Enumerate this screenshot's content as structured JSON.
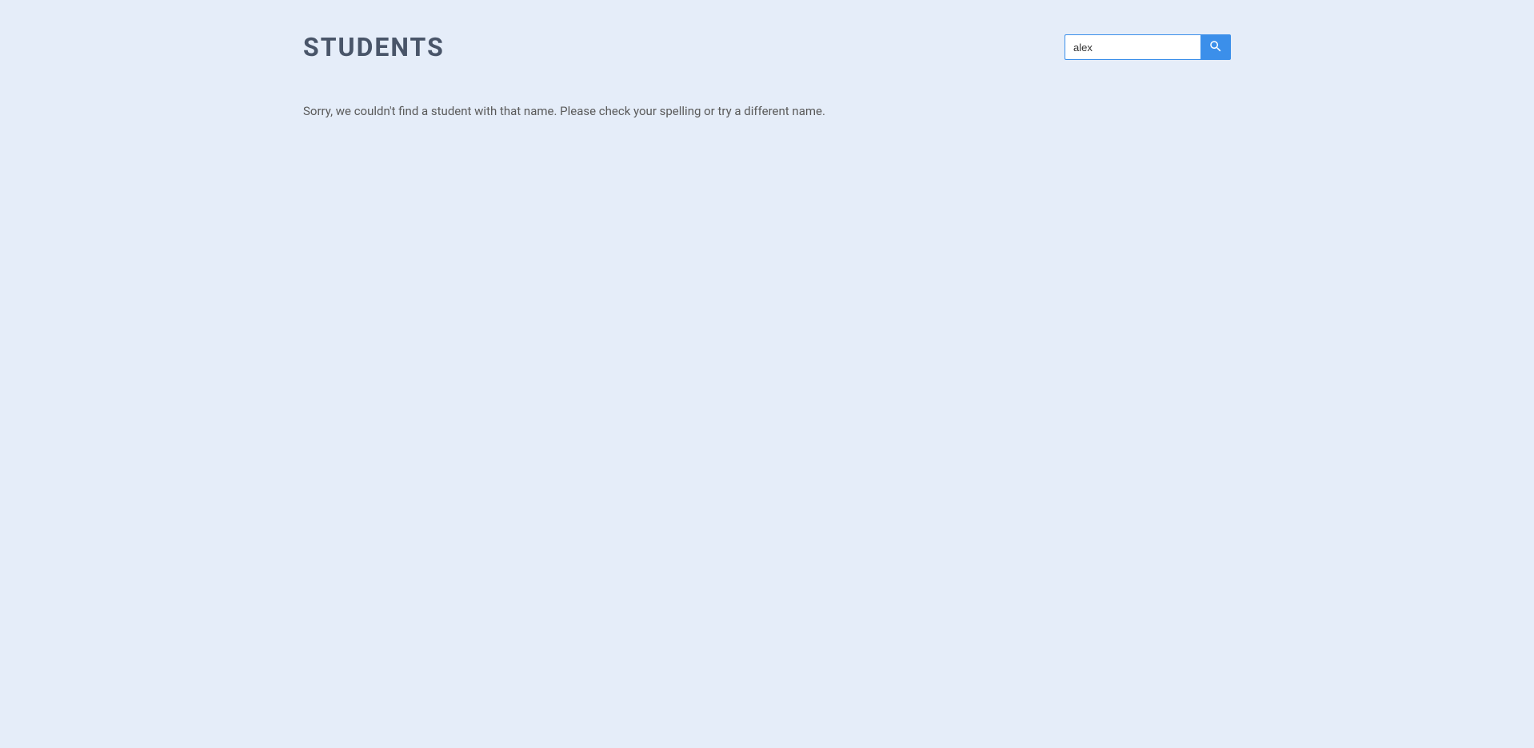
{
  "header": {
    "title": "STUDENTS"
  },
  "search": {
    "value": "alex",
    "placeholder": ""
  },
  "main": {
    "not_found_message": "Sorry, we couldn't find a student with that name. Please check your spelling or try a different name."
  },
  "colors": {
    "background": "#e5edf9",
    "title_text": "#495569",
    "accent": "#3b8fea",
    "body_text": "#5a5a5a"
  }
}
